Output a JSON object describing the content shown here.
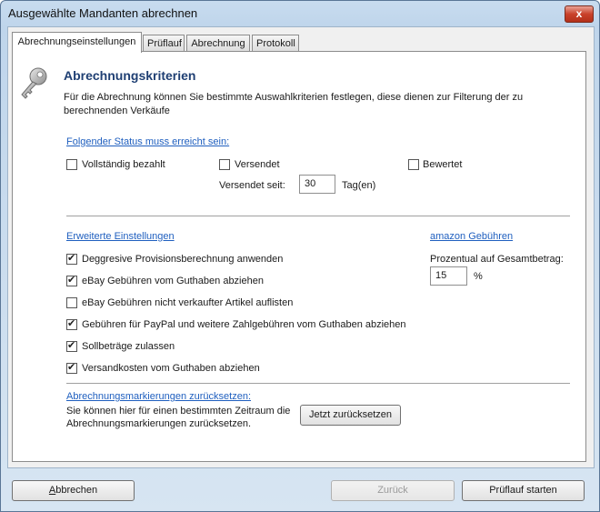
{
  "window": {
    "title": "Ausgewählte Mandanten abrechnen",
    "close_glyph": "x"
  },
  "tabs": [
    {
      "label": "Abrechnungseinstellungen",
      "active": true
    },
    {
      "label": "Prüflauf"
    },
    {
      "label": "Abrechnung"
    },
    {
      "label": "Protokoll"
    }
  ],
  "header": {
    "icon": "key-icon",
    "title": "Abrechnungskriterien",
    "desc_line1": "Für die Abrechnung können Sie bestimmte Auswahlkriterien festlegen, diese dienen zur Filterung der zu",
    "desc_line2": "berechnenden Verkäufe"
  },
  "status": {
    "heading": "Folgender Status muss erreicht sein:",
    "items": [
      {
        "label": "Vollständig bezahlt",
        "checked": false
      },
      {
        "label": "Versendet",
        "checked": false
      },
      {
        "label": "Bewertet",
        "checked": false
      }
    ],
    "shipped_since_label": "Versendet seit:",
    "shipped_since_value": "30",
    "shipped_since_unit": "Tag(en)"
  },
  "advanced": {
    "heading": "Erweiterte Einstellungen",
    "items": [
      {
        "label": "Deggresive Provisionsberechnung anwenden",
        "checked": true
      },
      {
        "label": "eBay Gebühren vom Guthaben abziehen",
        "checked": true
      },
      {
        "label": "eBay Gebühren nicht verkaufter Artikel auflisten",
        "checked": false
      },
      {
        "label": "Gebühren für PayPal und weitere Zahlgebühren vom Guthaben abziehen",
        "checked": true
      },
      {
        "label": "Sollbeträge zulassen",
        "checked": true
      },
      {
        "label": "Versandkosten vom Guthaben abziehen",
        "checked": true
      }
    ]
  },
  "amazon": {
    "heading": "amazon Gebühren",
    "percent_label": "Prozentual auf Gesamtbetrag:",
    "percent_value": "15",
    "percent_unit": "%"
  },
  "reset": {
    "heading": "Abrechnungsmarkierungen zurücksetzen:",
    "desc_line1": "Sie können hier für einen bestimmten Zeitraum die",
    "desc_line2": "Abrechnungsmarkierungen zurücksetzen.",
    "button": "Jetzt zurücksetzen"
  },
  "footer": {
    "cancel": "Abbrechen",
    "back": "Zurück",
    "start": "Prüflauf starten"
  },
  "colors": {
    "annotation_arrow": "#e04848",
    "section_title": "#1f3f73",
    "link": "#1f5fbf"
  }
}
